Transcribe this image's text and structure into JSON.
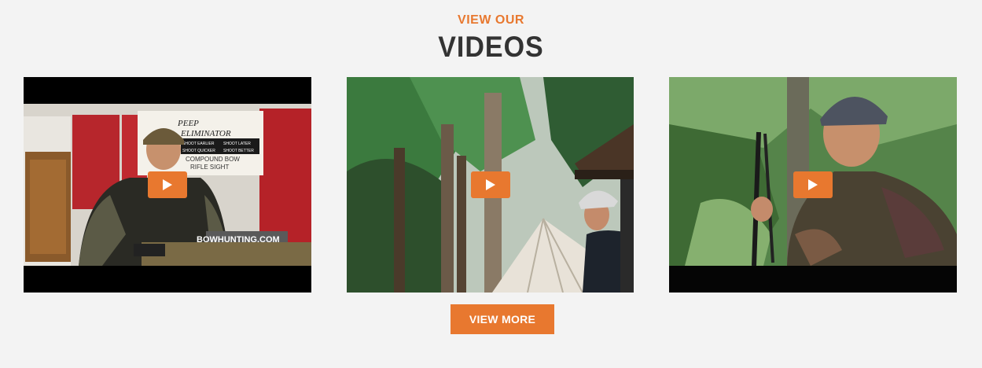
{
  "section": {
    "eyebrow": "VIEW OUR",
    "title": "VIDEOS"
  },
  "videos": [
    {
      "thumb_text": {
        "banner_line1": "PEEP",
        "banner_line2": "ELIMINATOR",
        "tag1": "SHOOT EARLIER",
        "tag2": "SHOOT LATER",
        "tag3": "SHOOT QUICKER",
        "tag4": "SHOOT BETTER",
        "banner_sub1": "COMPOUND BOW",
        "banner_sub2": "RIFLE SIGHT",
        "watermark": "BOWHUNTING.COM"
      },
      "play_icon": "play-icon"
    },
    {
      "play_icon": "play-icon"
    },
    {
      "play_icon": "play-icon"
    }
  ],
  "actions": {
    "view_more_label": "VIEW MORE"
  },
  "colors": {
    "accent": "#e8782f",
    "heading": "#333333",
    "background": "#f3f3f3"
  }
}
